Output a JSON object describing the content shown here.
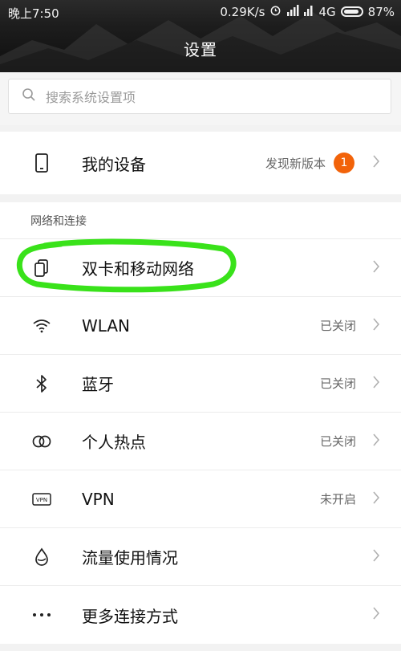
{
  "status_bar": {
    "time": "晚上7:50",
    "speed": "0.29K/s",
    "network": "4G",
    "battery": "87%"
  },
  "header": {
    "title": "设置"
  },
  "search": {
    "placeholder": "搜索系统设置项"
  },
  "device": {
    "label": "我的设备",
    "value": "发现新版本",
    "badge": "1"
  },
  "network_section": {
    "title": "网络和连接",
    "items": [
      {
        "label": "双卡和移动网络",
        "value": "",
        "icon": "dual-sim-icon"
      },
      {
        "label": "WLAN",
        "value": "已关闭",
        "icon": "wifi-icon"
      },
      {
        "label": "蓝牙",
        "value": "已关闭",
        "icon": "bluetooth-icon"
      },
      {
        "label": "个人热点",
        "value": "已关闭",
        "icon": "hotspot-icon"
      },
      {
        "label": "VPN",
        "value": "未开启",
        "icon": "vpn-icon"
      },
      {
        "label": "流量使用情况",
        "value": "",
        "icon": "data-usage-icon"
      },
      {
        "label": "更多连接方式",
        "value": "",
        "icon": "more-icon"
      }
    ]
  },
  "colors": {
    "badge": "#f2630a",
    "highlight": "#39e21a"
  }
}
